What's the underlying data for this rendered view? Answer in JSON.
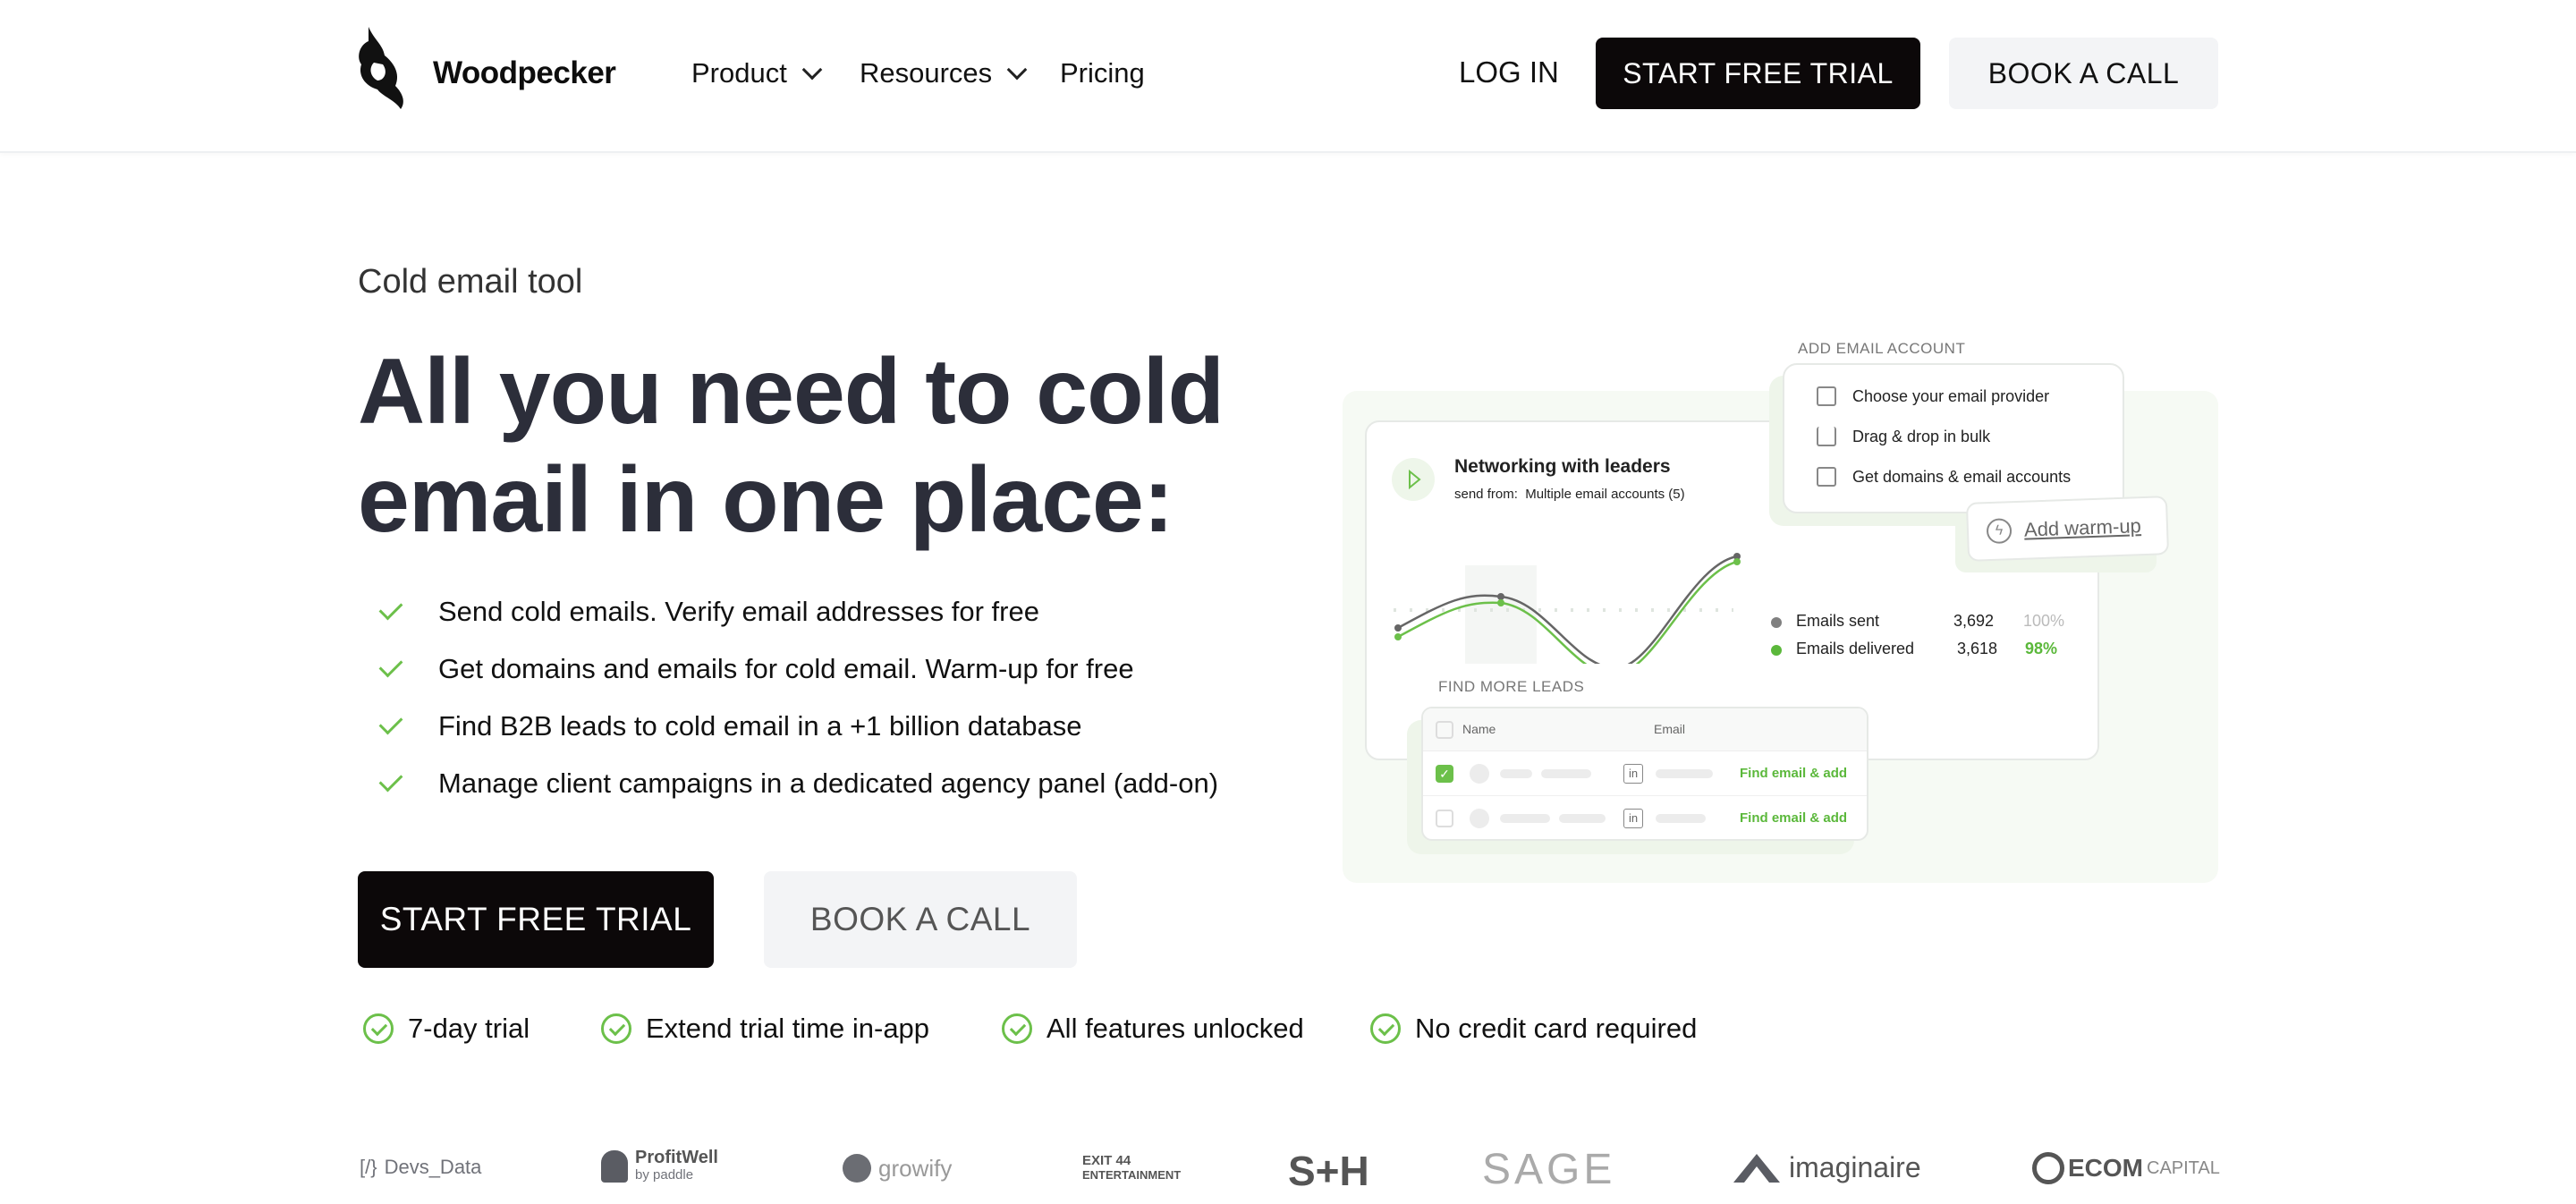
{
  "header": {
    "brand": "Woodpecker",
    "nav": [
      {
        "label": "Product",
        "has_dropdown": true
      },
      {
        "label": "Resources",
        "has_dropdown": true
      },
      {
        "label": "Pricing",
        "has_dropdown": false
      }
    ],
    "login_label": "LOG IN",
    "start_trial_label": "START FREE TRIAL",
    "book_call_label": "BOOK A CALL"
  },
  "hero": {
    "eyebrow": "Cold email tool",
    "title_line1": "All you need to cold",
    "title_line2": "email in one place:",
    "bullets": [
      "Send cold emails. Verify email addresses for free",
      "Get domains and emails for cold email. Warm-up for free",
      "Find B2B leads to cold email in a +1 billion database",
      "Manage client campaigns in a dedicated agency panel (add-on)"
    ],
    "start_trial_label": "START FREE TRIAL",
    "book_call_label": "BOOK A CALL",
    "features": [
      "7-day trial",
      "Extend trial time in-app",
      "All features unlocked",
      "No credit card required"
    ]
  },
  "illustration": {
    "campaign_title": "Networking with leaders",
    "send_from_label": "send from:",
    "send_from_value": "Multiple email accounts (5)",
    "stats": [
      {
        "label": "Emails sent",
        "value": "3,692",
        "percent": "100%",
        "color": "#808080"
      },
      {
        "label": "Emails delivered",
        "value": "3,618",
        "percent": "98%",
        "color": "#5bb83b"
      }
    ],
    "add_account_title": "ADD EMAIL ACCOUNT",
    "add_account_items": [
      "Choose your email provider",
      "Drag & drop in bulk",
      "Get domains & email accounts"
    ],
    "warmup_label": "Add warm-up",
    "leads_title": "FIND MORE LEADS",
    "leads_columns": [
      "Name",
      "Email"
    ],
    "leads_rows": [
      {
        "checked": true,
        "action": "Find email & add"
      },
      {
        "checked": false,
        "action": "Find email & add"
      }
    ]
  },
  "logos": [
    "Devs_Data",
    "ProfitWell",
    "by paddle",
    "growify",
    "EXIT 44",
    "ENTERTAINMENT",
    "S+H",
    "SAGE",
    "imaginaire",
    "ECOM",
    "CAPITAL"
  ],
  "colors": {
    "accent": "#5bb83b",
    "dark": "#0c0809",
    "heading": "#2c2e3a",
    "panel": "#f6faf4"
  }
}
